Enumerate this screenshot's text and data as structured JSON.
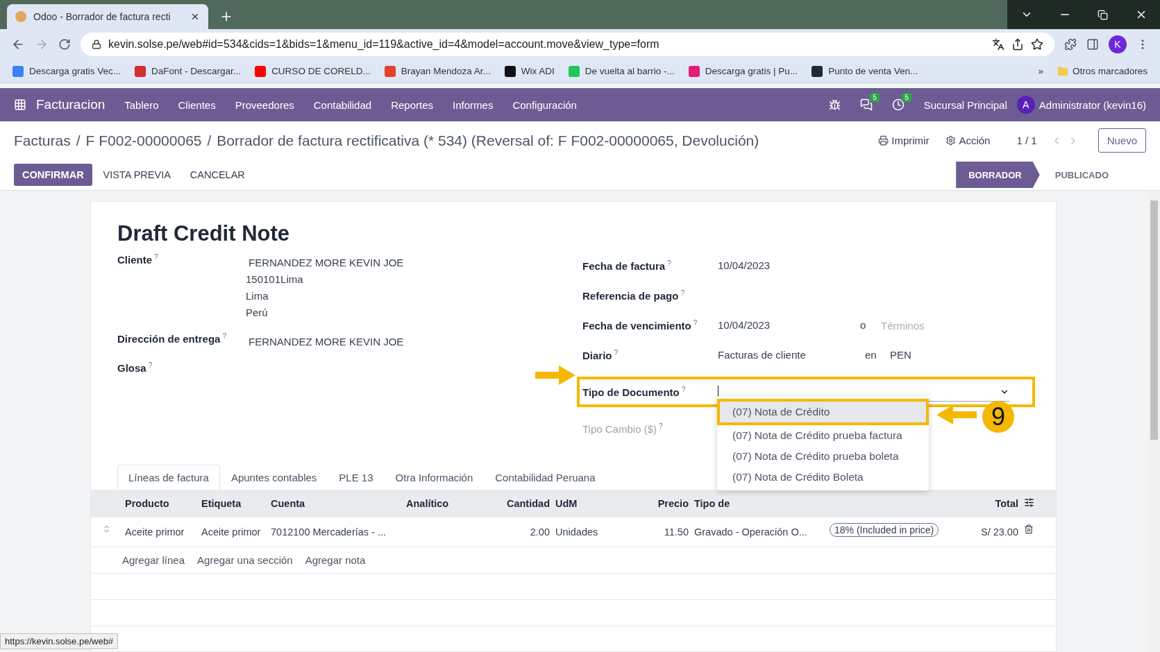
{
  "browser": {
    "tab_title": "Odoo - Borrador de factura recti",
    "url": "kevin.solse.pe/web#id=534&cids=1&bids=1&menu_id=119&active_id=4&model=account.move&view_type=form",
    "profile": "K",
    "bookmarks": [
      {
        "label": "Descarga gratis Vec...",
        "color": "#3b82f6"
      },
      {
        "label": "DaFont - Descargar...",
        "color": "#d32f2f"
      },
      {
        "label": "CURSO DE CORELD...",
        "color": "#ff0000"
      },
      {
        "label": "Brayan Mendoza Ar...",
        "color": "#e24329"
      },
      {
        "label": "Wix ADI",
        "color": "#111111"
      },
      {
        "label": "De vuelta al barrio -...",
        "color": "#22c55e"
      },
      {
        "label": "Descarga gratis | Pu...",
        "color": "#e11d74"
      },
      {
        "label": "Punto de venta Ven...",
        "color": "#1f2937"
      }
    ],
    "overflow": "»",
    "other_bookmarks": "Otros marcadores"
  },
  "navbar": {
    "app": "Facturacion",
    "menu": [
      "Tablero",
      "Clientes",
      "Proveedores",
      "Contabilidad",
      "Reportes",
      "Informes",
      "Configuración"
    ],
    "messages_badge": "5",
    "activities_badge": "5",
    "company": "Sucursal Principal",
    "avatar": "A",
    "user": "Administrator (kevin16)"
  },
  "breadcrumb": {
    "separator": "/",
    "items": [
      "Facturas",
      "F F002-00000065",
      "Borrador de factura rectificativa (* 534) (Reversal of: F F002-00000065, Devolución)"
    ]
  },
  "control_panel": {
    "print": "Imprimir",
    "action": "Acción",
    "pager": "1 / 1",
    "new": "Nuevo"
  },
  "buttons": [
    {
      "label": "CONFIRMAR",
      "kind": "primary"
    },
    {
      "label": "VISTA PREVIA",
      "kind": "link"
    },
    {
      "label": "CANCELAR",
      "kind": "link"
    }
  ],
  "statusbar": [
    {
      "label": "BORRADOR",
      "selected": true
    },
    {
      "label": "PUBLICADO",
      "selected": false
    }
  ],
  "form": {
    "title": "Draft Credit Note",
    "left_fields": [
      {
        "label": "Cliente",
        "help": "?",
        "lines": [
          "FERNANDEZ MORE KEVIN JOE",
          "150101Lima",
          "Lima",
          "Perú"
        ]
      },
      {
        "label": "Dirección de entrega",
        "help": "?",
        "lines": [
          "FERNANDEZ MORE KEVIN JOE"
        ]
      },
      {
        "label": "Glosa",
        "help": "?"
      }
    ],
    "right_fields": [
      {
        "label": "Fecha de factura",
        "help": "?",
        "kind": "text",
        "value": "10/04/2023",
        "disabled": false
      },
      {
        "label": "Referencia de pago",
        "help": "?",
        "kind": "text",
        "disabled": false
      },
      {
        "label": "Fecha de vencimiento",
        "help": "?",
        "kind": "due",
        "value": "10/04/2023",
        "joiner": "o",
        "placeholder": "Términos",
        "disabled": false
      },
      {
        "label": "Diario",
        "help": "?",
        "kind": "journal",
        "value": "Facturas de cliente",
        "joiner": "en",
        "currency": "PEN",
        "disabled": false
      },
      {
        "label": "Tipo de Documento",
        "help": "?",
        "kind": "select",
        "disabled": false,
        "options": [
          {
            "label": "(07) Nota de Crédito",
            "selected": true
          },
          {
            "label": "(07) Nota de Crédito prueba factura",
            "selected": false
          },
          {
            "label": "(07) Nota de Crédito prueba boleta",
            "selected": false
          },
          {
            "label": "(07) Nota de Crédito Boleta",
            "selected": false
          }
        ]
      },
      {
        "label": "Tipo Cambio ($)",
        "help": "?",
        "kind": "text",
        "disabled": true
      }
    ],
    "annotation": "9"
  },
  "notebook": {
    "tabs": [
      {
        "label": "Líneas de factura",
        "selected": true
      },
      {
        "label": "Apuntes contables",
        "selected": false
      },
      {
        "label": "PLE 13",
        "selected": false
      },
      {
        "label": "Otra Información",
        "selected": false
      },
      {
        "label": "Contabilidad Peruana",
        "selected": false
      }
    ],
    "columns": [
      "Producto",
      "Etiqueta",
      "Cuenta",
      "Analítico",
      "Cantidad",
      "UdM",
      "Precio",
      "Tipo de",
      "Total"
    ],
    "rows": [
      {
        "product": "Aceite primor",
        "label": "Aceite primor",
        "account": "7012100 Mercaderías - ...",
        "quantity": "2.00",
        "uom": "Unidades",
        "price": "11.50",
        "doc_type": "Gravado - Operación O...",
        "tax": "18% (Included in price)",
        "total": "S/ 23.00"
      }
    ],
    "add_links": [
      "Agregar línea",
      "Agregar una sección",
      "Agregar nota"
    ]
  },
  "status_bar": "https://kevin.solse.pe/web#"
}
